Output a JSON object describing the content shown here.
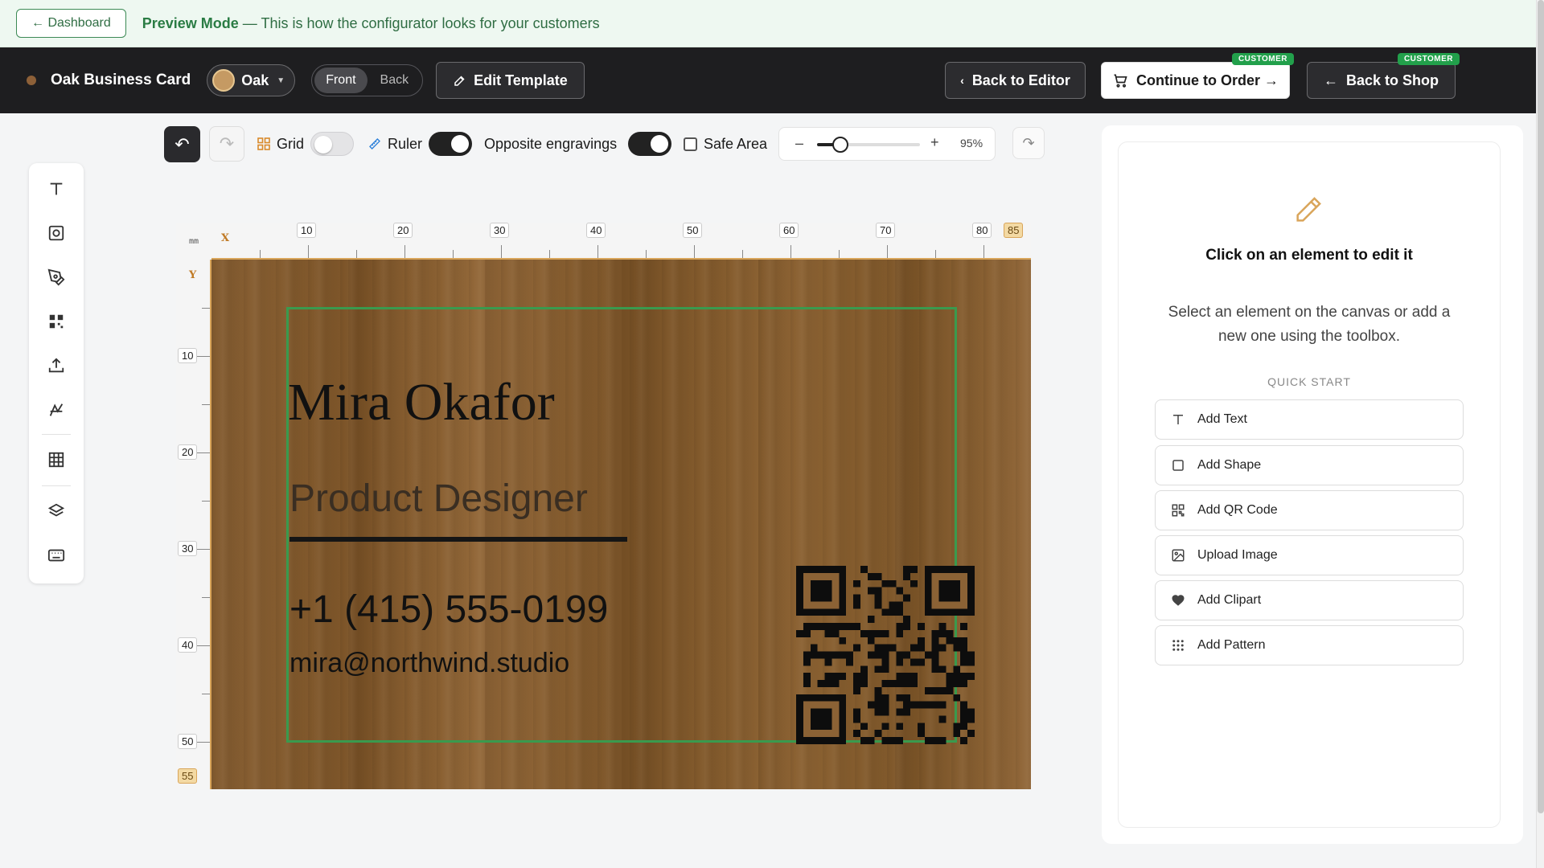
{
  "preview_bar": {
    "dashboard_label": "← Dashboard",
    "mode_title": "Preview Mode",
    "mode_desc": " — This is how the configurator looks for your customers"
  },
  "header": {
    "product_title": "Oak Business Card",
    "material": "Oak",
    "sides": [
      "Front",
      "Back"
    ],
    "active_side": "Front",
    "edit_template_label": "Edit Template",
    "back_to_editor_label": "Back to Editor",
    "continue_order_label": "Continue to Order →",
    "back_to_shop_label": "Back to Shop",
    "customer_badge": "CUSTOMER"
  },
  "toolbar": {
    "grid_label": "Grid",
    "grid_on": false,
    "ruler_label": "Ruler",
    "ruler_on": true,
    "opposite_label": "Opposite engravings",
    "opposite_on": true,
    "safe_area_label": "Safe Area",
    "safe_area_checked": false,
    "zoom_minus": "–",
    "zoom_plus": "+",
    "zoom_value": "95%",
    "zoom_fraction": 0.23
  },
  "toolbox": {
    "icons": [
      "text-tool-icon",
      "shape-tool-icon",
      "pen-tool-icon",
      "qr-tool-icon",
      "upload-tool-icon",
      "clipart-tool-icon",
      "pattern-tool-icon",
      "layers-tool-icon",
      "keyboard-tool-icon"
    ]
  },
  "ruler": {
    "unit": "mm",
    "x_letter": "X",
    "y_letter": "Y",
    "x_ticks": [
      "10",
      "20",
      "30",
      "40",
      "50",
      "60",
      "70",
      "80"
    ],
    "x_end": "85",
    "y_ticks": [
      "10",
      "20",
      "30",
      "40",
      "50"
    ],
    "y_end": "55"
  },
  "card": {
    "name": "Mira Okafor",
    "role": "Product Designer",
    "phone": "+1 (415) 555-0199",
    "email": "mira@northwind.studio",
    "colors": {
      "wood": "#8b6235",
      "safe_area": "#3a9a4e",
      "engrave": "#111111"
    }
  },
  "panel": {
    "title": "Click on an element to edit it",
    "description": "Select an element on the canvas or add a new one using the toolbox.",
    "quick_start_label": "QUICK START",
    "actions": [
      {
        "label": "Add Text",
        "icon": "text-icon"
      },
      {
        "label": "Add Shape",
        "icon": "square-icon"
      },
      {
        "label": "Add QR Code",
        "icon": "qr-icon"
      },
      {
        "label": "Upload Image",
        "icon": "image-icon"
      },
      {
        "label": "Add Clipart",
        "icon": "heart-icon"
      },
      {
        "label": "Add Pattern",
        "icon": "pattern-icon"
      }
    ]
  }
}
